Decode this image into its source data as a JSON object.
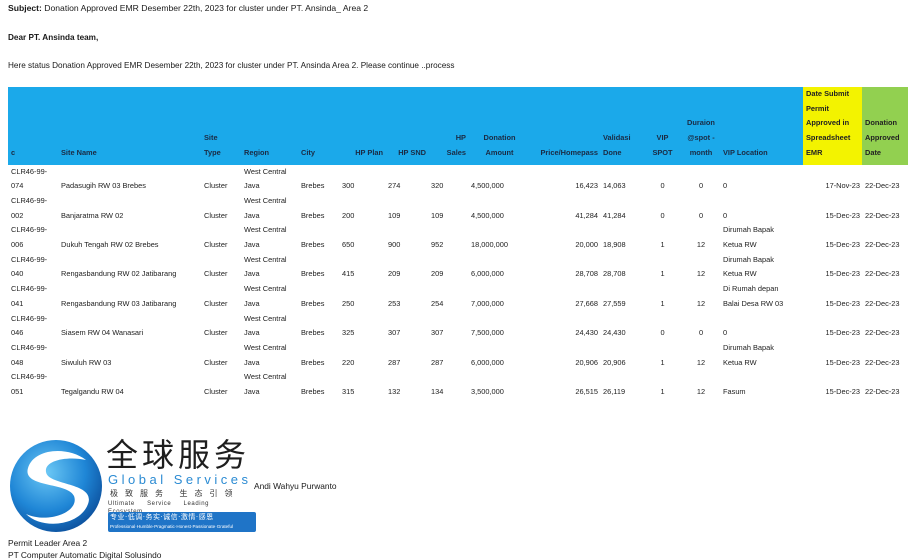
{
  "email": {
    "subject_label": "Subject:",
    "subject_text": "Donation Approved EMR Desember 22th, 2023 for cluster under PT. Ansinda_ Area 2",
    "greeting": "Dear PT. Ansinda team,",
    "intro": "Here status Donation Approved EMR Desember 22th, 2023  for cluster  under PT. Ansinda Area 2.  Please continue ..process"
  },
  "table": {
    "headers": {
      "c": "c",
      "site_name": "Site Name",
      "site_type_1": "Site",
      "site_type_2": "Type",
      "region": "Region",
      "city": "City",
      "hp_plan": "HP Plan",
      "hp_snd": "HP SND",
      "hp_sales_1": "HP",
      "hp_sales_2": "Sales",
      "donation_1": "Donation",
      "donation_2": "Amount",
      "price": "Price/Homepass",
      "validasi_1": "Validasi",
      "validasi_2": "Done",
      "vip_spot_1": "VIP",
      "vip_spot_2": "SPOT",
      "duration_1": "Duraion",
      "duration_2": "@spot -",
      "duration_3": "month",
      "vip_location": "VIP Location",
      "date_submit_1": "Date Submit",
      "date_submit_2": "Permit",
      "date_submit_3": "Approved in",
      "date_submit_4": "Spreadsheet",
      "date_submit_5": "EMR",
      "donation_date_1": "Donation",
      "donation_date_2": "Approved",
      "donation_date_3": "Date"
    },
    "rows": [
      {
        "id_1": "CLR46-99-",
        "id_2": "074",
        "site_name": "Padasugih RW 03 Brebes",
        "site_type": "Cluster",
        "region_1": "West Central",
        "region_2": "Java",
        "city": "Brebes",
        "hp_plan": "300",
        "hp_snd": "274",
        "hp_sales": "320",
        "donation": "4,500,000",
        "price": "16,423",
        "validasi": "14,063",
        "vip_spot": "0",
        "duration": "0",
        "vip_loc_1": "",
        "vip_loc_2": "0",
        "date_submit": "17-Nov-23",
        "donation_date": "22-Dec-23"
      },
      {
        "id_1": "CLR46-99-",
        "id_2": "002",
        "site_name": "Banjaratma RW 02",
        "site_type": "Cluster",
        "region_1": "West Central",
        "region_2": "Java",
        "city": "Brebes",
        "hp_plan": "200",
        "hp_snd": "109",
        "hp_sales": "109",
        "donation": "4,500,000",
        "price": "41,284",
        "validasi": "41,284",
        "vip_spot": "0",
        "duration": "0",
        "vip_loc_1": "",
        "vip_loc_2": "0",
        "date_submit": "15-Dec-23",
        "donation_date": "22-Dec-23"
      },
      {
        "id_1": "CLR46-99-",
        "id_2": "006",
        "site_name": "Dukuh Tengah RW 02 Brebes",
        "site_type": "Cluster",
        "region_1": "West Central",
        "region_2": "Java",
        "city": "Brebes",
        "hp_plan": "650",
        "hp_snd": "900",
        "hp_sales": "952",
        "donation": "18,000,000",
        "price": "20,000",
        "validasi": "18,908",
        "vip_spot": "1",
        "duration": "12",
        "vip_loc_1": "Dirumah Bapak",
        "vip_loc_2": "Ketua RW",
        "date_submit": "15-Dec-23",
        "donation_date": "22-Dec-23"
      },
      {
        "id_1": "CLR46-99-",
        "id_2": "040",
        "site_name": "Rengasbandung RW 02 Jatibarang",
        "site_type": "Cluster",
        "region_1": "West Central",
        "region_2": "Java",
        "city": "Brebes",
        "hp_plan": "415",
        "hp_snd": "209",
        "hp_sales": "209",
        "donation": "6,000,000",
        "price": "28,708",
        "validasi": "28,708",
        "vip_spot": "1",
        "duration": "12",
        "vip_loc_1": "Dirumah Bapak",
        "vip_loc_2": "Ketua RW",
        "date_submit": "15-Dec-23",
        "donation_date": "22-Dec-23"
      },
      {
        "id_1": "CLR46-99-",
        "id_2": "041",
        "site_name": "Rengasbandung RW 03 Jatibarang",
        "site_type": "Cluster",
        "region_1": "West Central",
        "region_2": "Java",
        "city": "Brebes",
        "hp_plan": "250",
        "hp_snd": "253",
        "hp_sales": "254",
        "donation": "7,000,000",
        "price": "27,668",
        "validasi": "27,559",
        "vip_spot": "1",
        "duration": "12",
        "vip_loc_1": "Di Rumah depan",
        "vip_loc_2": "Balai Desa RW 03",
        "date_submit": "15-Dec-23",
        "donation_date": "22-Dec-23"
      },
      {
        "id_1": "CLR46-99-",
        "id_2": "046",
        "site_name": "Siasem RW 04 Wanasari",
        "site_type": "Cluster",
        "region_1": "West Central",
        "region_2": "Java",
        "city": "Brebes",
        "hp_plan": "325",
        "hp_snd": "307",
        "hp_sales": "307",
        "donation": "7,500,000",
        "price": "24,430",
        "validasi": "24,430",
        "vip_spot": "0",
        "duration": "0",
        "vip_loc_1": "",
        "vip_loc_2": "0",
        "date_submit": "15-Dec-23",
        "donation_date": "22-Dec-23"
      },
      {
        "id_1": "CLR46-99-",
        "id_2": "048",
        "site_name": "Siwuluh RW 03",
        "site_type": "Cluster",
        "region_1": "West Central",
        "region_2": "Java",
        "city": "Brebes",
        "hp_plan": "220",
        "hp_snd": "287",
        "hp_sales": "287",
        "donation": "6,000,000",
        "price": "20,906",
        "validasi": "20,906",
        "vip_spot": "1",
        "duration": "12",
        "vip_loc_1": "Dirumah Bapak",
        "vip_loc_2": "Ketua RW",
        "date_submit": "15-Dec-23",
        "donation_date": "22-Dec-23"
      },
      {
        "id_1": "CLR46-99-",
        "id_2": "051",
        "site_name": "Tegalgandu RW 04",
        "site_type": "Cluster",
        "region_1": "West Central",
        "region_2": "Java",
        "city": "Brebes",
        "hp_plan": "315",
        "hp_snd": "132",
        "hp_sales": "134",
        "donation": "3,500,000",
        "price": "26,515",
        "validasi": "26,119",
        "vip_spot": "1",
        "duration": "12",
        "vip_loc_1": "",
        "vip_loc_2": "Fasum",
        "date_submit": "15-Dec-23",
        "donation_date": "22-Dec-23"
      }
    ]
  },
  "logo": {
    "zh_title": "全球服务",
    "en_title": "Global Services",
    "zh_tagline": "极致服务 生态引领",
    "en_tagline": "Ultimate Service   Leading Ecosystem",
    "band_zh": "专业·低调·务实·诚信·激情·感恩",
    "band_en": "Professional·Humble·Pragmatic·Honest·Passionate·Grateful",
    "colors": {
      "primary": "#1f74c7",
      "accent": "#2b8bd3"
    }
  },
  "signature": {
    "name": "Andi Wahyu Purwanto",
    "role": "Permit Leader Area 2",
    "company": "PT Computer Automatic Digital Solusindo"
  },
  "colors": {
    "header_blue": "#1ba9ea",
    "header_yellow": "#f3f300",
    "header_green": "#92d050"
  }
}
